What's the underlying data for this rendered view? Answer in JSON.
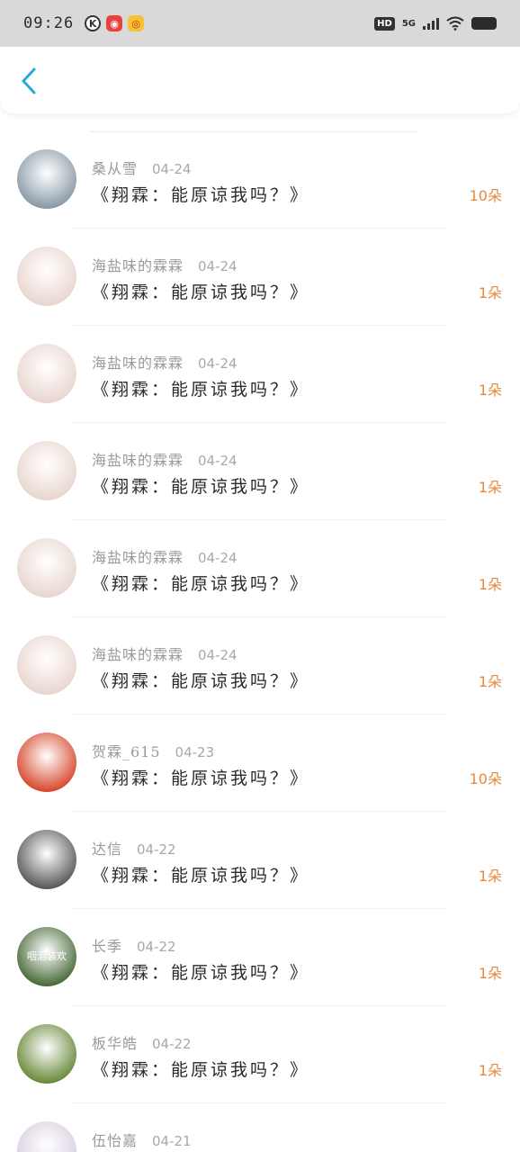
{
  "status_bar": {
    "time": "09:26",
    "network": "5G",
    "hd": "HD",
    "apps": [
      "k-app-icon",
      "album-app-icon",
      "weibo-app-icon"
    ]
  },
  "header": {
    "back_icon": "chevron-left-icon"
  },
  "colors": {
    "accent_back": "#29a8e0",
    "count": "#e8893a"
  },
  "items": [
    {
      "name": "桑从雪",
      "date": "04-24",
      "title": "《翔霖：能原谅我吗？》",
      "count": "10朵",
      "avatar_color": "#8a9aa8"
    },
    {
      "name": "海盐味的霖霖",
      "date": "04-24",
      "title": "《翔霖：能原谅我吗？》",
      "count": "1朵",
      "avatar_color": "#e9d6cf"
    },
    {
      "name": "海盐味的霖霖",
      "date": "04-24",
      "title": "《翔霖：能原谅我吗？》",
      "count": "1朵",
      "avatar_color": "#e9d6cf"
    },
    {
      "name": "海盐味的霖霖",
      "date": "04-24",
      "title": "《翔霖：能原谅我吗？》",
      "count": "1朵",
      "avatar_color": "#e9d6cf"
    },
    {
      "name": "海盐味的霖霖",
      "date": "04-24",
      "title": "《翔霖：能原谅我吗？》",
      "count": "1朵",
      "avatar_color": "#e9d6cf"
    },
    {
      "name": "海盐味的霖霖",
      "date": "04-24",
      "title": "《翔霖：能原谅我吗？》",
      "count": "1朵",
      "avatar_color": "#e9d6cf"
    },
    {
      "name": "贺霖_615",
      "date": "04-23",
      "title": "《翔霖：能原谅我吗？》",
      "count": "10朵",
      "avatar_color": "#d8492f"
    },
    {
      "name": "达信",
      "date": "04-22",
      "title": "《翔霖：能原谅我吗？》",
      "count": "1朵",
      "avatar_color": "#5a5a5a"
    },
    {
      "name": "长季",
      "date": "04-22",
      "title": "《翔霖：能原谅我吗？》",
      "count": "1朵",
      "avatar_color": "#4a6b3a",
      "avatar_text": "咽泪装欢"
    },
    {
      "name": "板华皓",
      "date": "04-22",
      "title": "《翔霖：能原谅我吗？》",
      "count": "1朵",
      "avatar_color": "#6a8a3a"
    },
    {
      "name": "伍怡嘉",
      "date": "04-21",
      "title": "",
      "count": "",
      "avatar_color": "#d9cfe0"
    }
  ]
}
